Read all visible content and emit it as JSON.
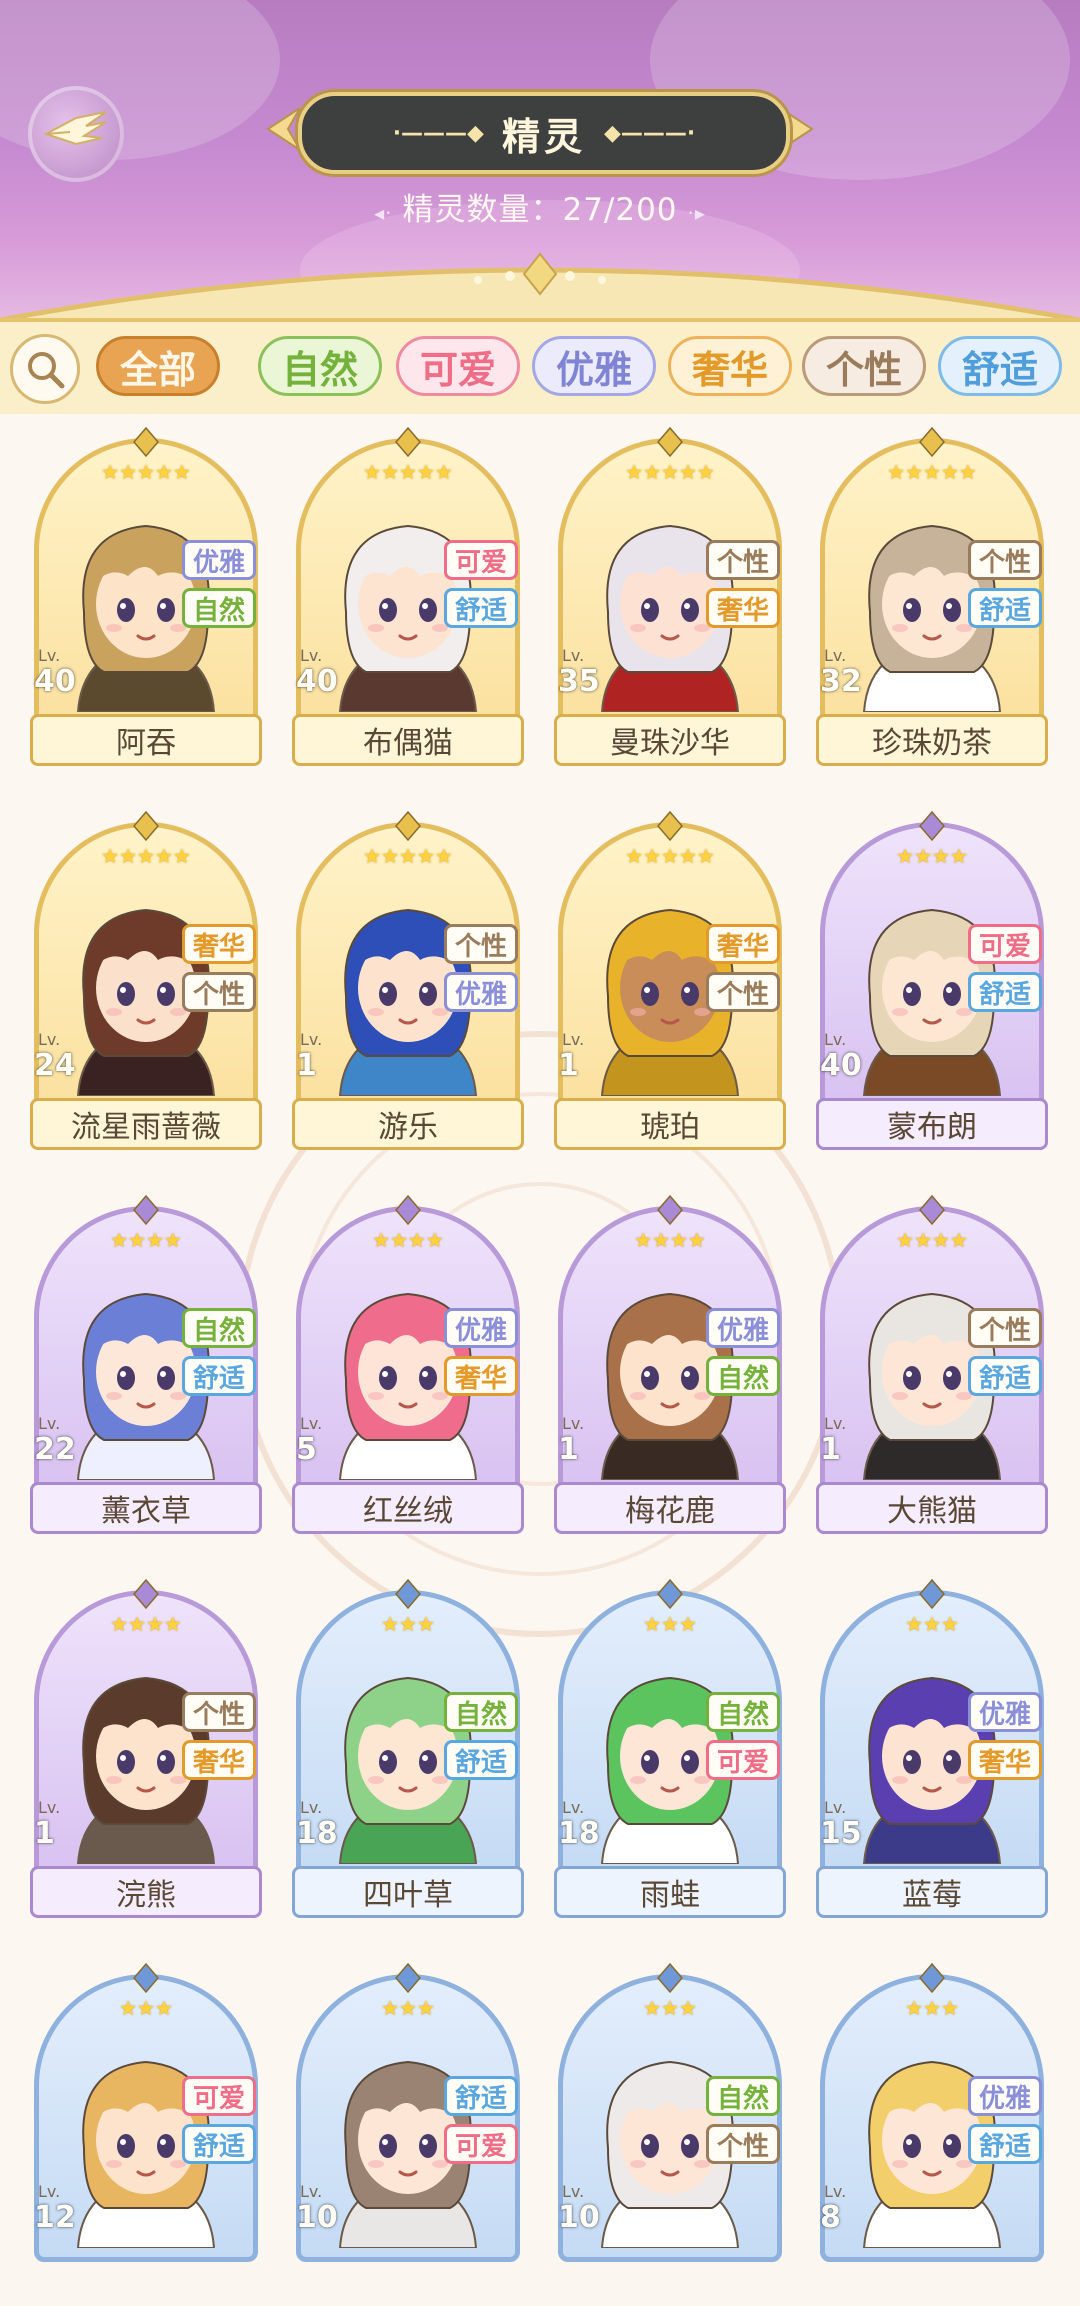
{
  "header": {
    "title": "精灵",
    "count_label": "精灵数量：",
    "count_value": "27/200"
  },
  "filters": {
    "search_icon": "magnifier-icon",
    "tabs": [
      {
        "label": "全部",
        "active": true
      },
      {
        "label": "自然"
      },
      {
        "label": "可爱"
      },
      {
        "label": "优雅"
      },
      {
        "label": "奢华"
      },
      {
        "label": "个性"
      },
      {
        "label": "舒适"
      }
    ]
  },
  "tag_colors": {
    "优雅": "#8a8fd8",
    "自然": "#74b23b",
    "可爱": "#ef6d86",
    "舒适": "#5aa6df",
    "个性": "#9a7b5c",
    "奢华": "#e39a2a"
  },
  "cards": [
    {
      "name": "阿吞",
      "level": "40",
      "tags": [
        "优雅",
        "自然"
      ],
      "stars": 5,
      "tier": "gold"
    },
    {
      "name": "布偶猫",
      "level": "40",
      "tags": [
        "可爱",
        "舒适"
      ],
      "stars": 5,
      "tier": "gold"
    },
    {
      "name": "曼珠沙华",
      "level": "35",
      "tags": [
        "个性",
        "奢华"
      ],
      "stars": 5,
      "tier": "gold"
    },
    {
      "name": "珍珠奶茶",
      "level": "32",
      "tags": [
        "个性",
        "舒适"
      ],
      "stars": 5,
      "tier": "gold"
    },
    {
      "name": "流星雨蔷薇",
      "level": "24",
      "tags": [
        "奢华",
        "个性"
      ],
      "stars": 5,
      "tier": "gold"
    },
    {
      "name": "游乐",
      "level": "1",
      "tags": [
        "个性",
        "优雅"
      ],
      "stars": 5,
      "tier": "gold"
    },
    {
      "name": "琥珀",
      "level": "1",
      "tags": [
        "奢华",
        "个性"
      ],
      "stars": 5,
      "tier": "gold"
    },
    {
      "name": "蒙布朗",
      "level": "40",
      "tags": [
        "可爱",
        "舒适"
      ],
      "stars": 4,
      "tier": "purple"
    },
    {
      "name": "薰衣草",
      "level": "22",
      "tags": [
        "自然",
        "舒适"
      ],
      "stars": 4,
      "tier": "purple"
    },
    {
      "name": "红丝绒",
      "level": "5",
      "tags": [
        "优雅",
        "奢华"
      ],
      "stars": 4,
      "tier": "purple"
    },
    {
      "name": "梅花鹿",
      "level": "1",
      "tags": [
        "优雅",
        "自然"
      ],
      "stars": 4,
      "tier": "purple"
    },
    {
      "name": "大熊猫",
      "level": "1",
      "tags": [
        "个性",
        "舒适"
      ],
      "stars": 4,
      "tier": "purple"
    },
    {
      "name": "浣熊",
      "level": "1",
      "tags": [
        "个性",
        "奢华"
      ],
      "stars": 4,
      "tier": "purple"
    },
    {
      "name": "四叶草",
      "level": "18",
      "tags": [
        "自然",
        "舒适"
      ],
      "stars": 3,
      "tier": "blue"
    },
    {
      "name": "雨蛙",
      "level": "18",
      "tags": [
        "自然",
        "可爱"
      ],
      "stars": 3,
      "tier": "blue"
    },
    {
      "name": "蓝莓",
      "level": "15",
      "tags": [
        "优雅",
        "奢华"
      ],
      "stars": 3,
      "tier": "blue"
    },
    {
      "name": "",
      "level": "12",
      "tags": [
        "可爱",
        "舒适"
      ],
      "stars": 3,
      "tier": "blue"
    },
    {
      "name": "",
      "level": "10",
      "tags": [
        "舒适",
        "可爱"
      ],
      "stars": 3,
      "tier": "blue"
    },
    {
      "name": "",
      "level": "10",
      "tags": [
        "自然",
        "个性"
      ],
      "stars": 3,
      "tier": "blue"
    },
    {
      "name": "",
      "level": "8",
      "tags": [
        "优雅",
        "舒适"
      ],
      "stars": 3,
      "tier": "blue"
    }
  ],
  "level_prefix": "Lv.",
  "portrait_palettes": [
    {
      "hair": "#c9a25e",
      "skin": "#fde4c8",
      "cloth": "#5c4a2e"
    },
    {
      "hair": "#f2eeee",
      "skin": "#fde4d0",
      "cloth": "#5a3a30"
    },
    {
      "hair": "#e9e4ec",
      "skin": "#fde2d4",
      "cloth": "#b02323"
    },
    {
      "hair": "#c7b29a",
      "skin": "#fde6d2",
      "cloth": "#ffffff"
    },
    {
      "hair": "#6e3b2a",
      "skin": "#fbe0cc",
      "cloth": "#3a2222"
    },
    {
      "hair": "#2f4fb8",
      "skin": "#fde3cd",
      "cloth": "#3f86c9"
    },
    {
      "hair": "#e8b22b",
      "skin": "#c98d5a",
      "cloth": "#c3951f"
    },
    {
      "hair": "#e6d5b6",
      "skin": "#fde6d2",
      "cloth": "#7a4a26"
    },
    {
      "hair": "#6b7fd6",
      "skin": "#fde7d8",
      "cloth": "#eef0ff"
    },
    {
      "hair": "#ef6c8c",
      "skin": "#fde4d6",
      "cloth": "#ffffff"
    },
    {
      "hair": "#a8714a",
      "skin": "#fde3cc",
      "cloth": "#3a2a24"
    },
    {
      "hair": "#e9e6e2",
      "skin": "#fde6d6",
      "cloth": "#2e2a2a"
    },
    {
      "hair": "#5b3b2c",
      "skin": "#fde3cc",
      "cloth": "#6a5a4e"
    },
    {
      "hair": "#8ed28a",
      "skin": "#fde6d2",
      "cloth": "#49a456"
    },
    {
      "hair": "#5bc45e",
      "skin": "#fde6d6",
      "cloth": "#ffffff"
    },
    {
      "hair": "#5a3fb0",
      "skin": "#fde3d2",
      "cloth": "#3b3b8a"
    },
    {
      "hair": "#e8b560",
      "skin": "#fde3cc",
      "cloth": "#ffffff"
    },
    {
      "hair": "#9a8372",
      "skin": "#fde6d6",
      "cloth": "#e9e6e6"
    },
    {
      "hair": "#efeaea",
      "skin": "#fde6d6",
      "cloth": "#ffffff"
    },
    {
      "hair": "#f2cf6b",
      "skin": "#fde6d6",
      "cloth": "#ffffff"
    }
  ]
}
